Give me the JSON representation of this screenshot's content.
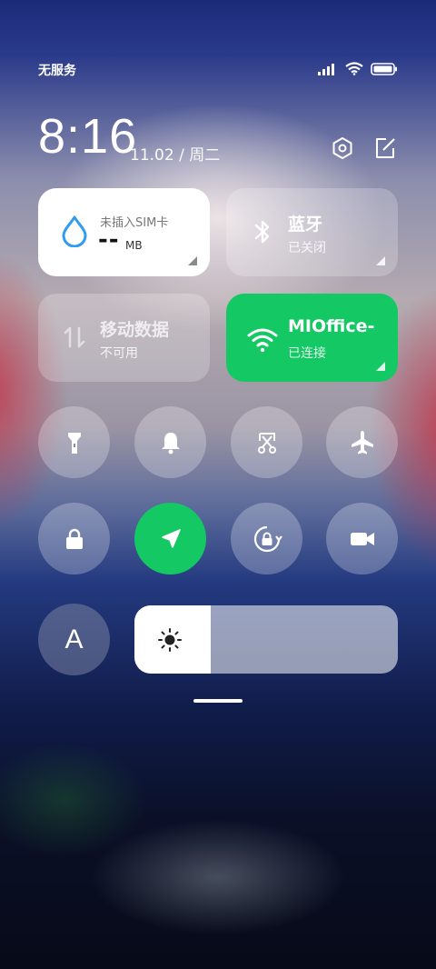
{
  "status_bar": {
    "carrier": "无服务",
    "icons": [
      "signal-icon",
      "wifi-icon",
      "battery-icon"
    ]
  },
  "header": {
    "time": "8:16",
    "date": "11.02 / 周二",
    "icons": [
      "settings-icon",
      "edit-icon"
    ]
  },
  "tiles": {
    "data": {
      "title": "未插入SIM卡",
      "value": "--",
      "unit": "MB",
      "icon": "water-drop-icon"
    },
    "bluetooth": {
      "title": "蓝牙",
      "subtitle": "已关闭",
      "icon": "bluetooth-icon"
    },
    "mobile_data": {
      "title": "移动数据",
      "subtitle": "不可用",
      "icon": "mobile-data-icon"
    },
    "wifi": {
      "title": "MIOffice-",
      "subtitle": "已连接",
      "icon": "wifi-icon"
    }
  },
  "toggles_row1": [
    {
      "name": "flashlight",
      "icon": "flashlight-icon",
      "active": false
    },
    {
      "name": "silent",
      "icon": "bell-icon",
      "active": false
    },
    {
      "name": "screenshot",
      "icon": "screenshot-icon",
      "active": false
    },
    {
      "name": "airplane",
      "icon": "airplane-icon",
      "active": false
    }
  ],
  "toggles_row2": [
    {
      "name": "lock-screen",
      "icon": "lock-icon",
      "active": false
    },
    {
      "name": "location",
      "icon": "location-icon",
      "active": true
    },
    {
      "name": "rotation-lock",
      "icon": "rotation-lock-icon",
      "active": false
    },
    {
      "name": "screen-record",
      "icon": "video-icon",
      "active": false
    }
  ],
  "auto_brightness": {
    "label": "A"
  },
  "brightness": {
    "level": 0.29,
    "icon": "sun-icon"
  },
  "colors": {
    "green": "#14c864",
    "blue_drop": "#2f9cf0"
  }
}
